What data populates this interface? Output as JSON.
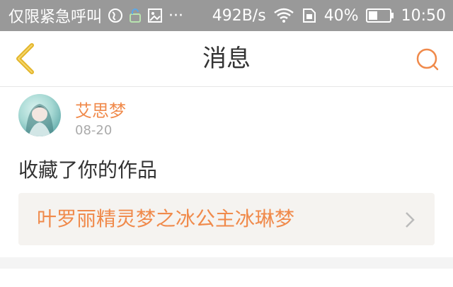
{
  "status_bar": {
    "carrier": "仅限紧急呼叫",
    "more": "···",
    "speed": "492B/s",
    "battery": "40%",
    "time": "10:50"
  },
  "nav": {
    "title": "消息"
  },
  "message": {
    "user": "艾思梦",
    "date": "08-20",
    "action": "收藏了你的作品",
    "work_title": "叶罗丽精灵梦之冰公主冰琳梦"
  },
  "colors": {
    "accent": "#f08a4b",
    "status_bar": "#999999"
  }
}
